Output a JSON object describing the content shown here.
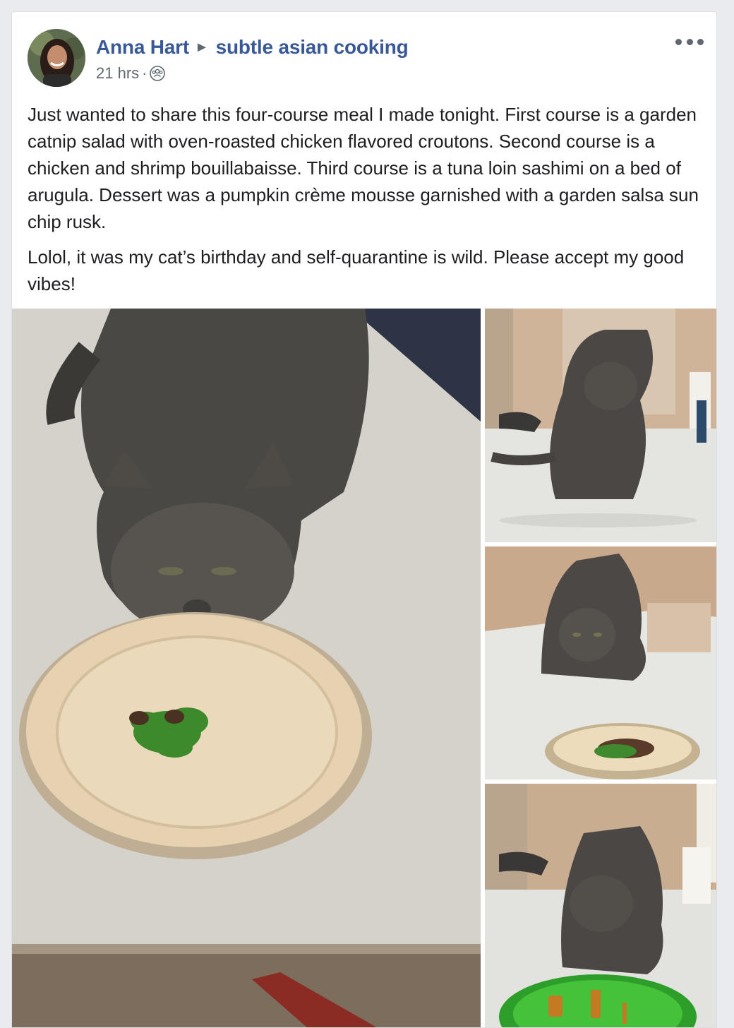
{
  "post": {
    "author": "Anna Hart",
    "group": "subtle asian cooking",
    "timestamp": "21 hrs",
    "separator_dot": "·",
    "audience_icon": "group-audience-icon",
    "more_icon": "more-options-icon",
    "paragraphs": [
      "Just wanted to share this four-course meal I made tonight. First course is a garden catnip salad with oven-roasted chicken flavored croutons. Second course is a chicken and shrimp bouillabaisse. Third course is a tuna loin sashimi on a bed of arugula. Dessert was a pumpkin crème mousse garnished with a garden salsa sun chip rusk.",
      "Lolol, it was my cat’s birthday and self-quarantine is wild. Please accept my good vibes!"
    ]
  },
  "colors": {
    "link": "#385898",
    "text": "#1c1e21",
    "meta": "#606770",
    "background": "#e9ebee",
    "card": "#ffffff"
  }
}
